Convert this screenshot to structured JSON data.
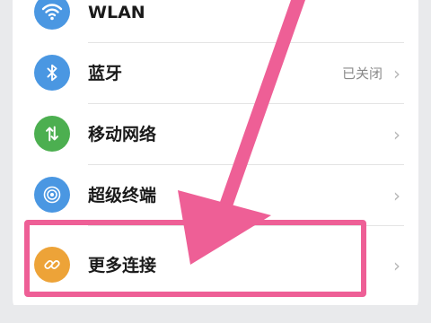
{
  "settings_list": [
    {
      "id": "wlan",
      "label": "WLAN",
      "status": "",
      "icon": "wifi-icon",
      "icon_color": "#4a97e2"
    },
    {
      "id": "bluetooth",
      "label": "蓝牙",
      "status": "已关闭",
      "icon": "bluetooth-icon",
      "icon_color": "#4a97e2"
    },
    {
      "id": "mobile",
      "label": "移动网络",
      "status": "",
      "icon": "mobile-data-icon",
      "icon_color": "#4caf50"
    },
    {
      "id": "superdevice",
      "label": "超级终端",
      "status": "",
      "icon": "super-device-icon",
      "icon_color": "#4a97e2"
    },
    {
      "id": "more",
      "label": "更多连接",
      "status": "",
      "icon": "link-icon",
      "icon_color": "#eda338"
    }
  ],
  "annotation": {
    "color": "#ee5f96"
  }
}
